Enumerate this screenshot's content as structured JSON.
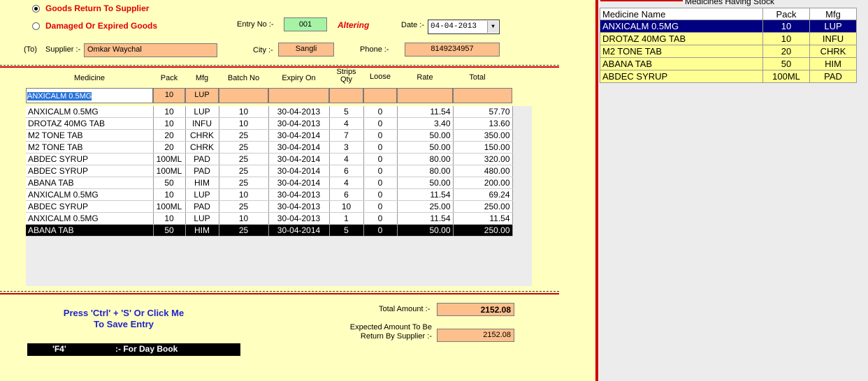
{
  "mode": {
    "option1": "Goods Return To Supplier",
    "option2": "Damaged Or Expired Goods"
  },
  "entry": {
    "label": "Entry No :-",
    "value": "001",
    "status": "Altering"
  },
  "date": {
    "label": "Date :-",
    "value": "04-04-2013"
  },
  "supplier": {
    "prefix": "(To)",
    "label": "Supplier :-",
    "value": "Omkar Waychal"
  },
  "city": {
    "label": "City :-",
    "value": "Sangli"
  },
  "phone": {
    "label": "Phone :-",
    "value": "8149234957"
  },
  "columns": {
    "medicine": "Medicine",
    "pack": "Pack",
    "mfg": "Mfg",
    "batch": "Batch No",
    "expiry": "Expiry On",
    "strips1": "Strips",
    "strips2": "Qty",
    "loose": "Loose",
    "rate": "Rate",
    "total": "Total"
  },
  "entry_row": {
    "medicine": "ANXICALM 0.5MG",
    "pack": "10",
    "mfg": "LUP"
  },
  "rows": [
    {
      "medicine": "ANXICALM 0.5MG",
      "pack": "10",
      "mfg": "LUP",
      "batch": "10",
      "expiry": "30-04-2013",
      "qty": "5",
      "loose": "0",
      "rate": "11.54",
      "total": "57.70"
    },
    {
      "medicine": "DROTAZ  40MG TAB",
      "pack": "10",
      "mfg": "INFU",
      "batch": "10",
      "expiry": "30-04-2013",
      "qty": "4",
      "loose": "0",
      "rate": "3.40",
      "total": "13.60"
    },
    {
      "medicine": "M2 TONE TAB",
      "pack": "20",
      "mfg": "CHRK",
      "batch": "25",
      "expiry": "30-04-2014",
      "qty": "7",
      "loose": "0",
      "rate": "50.00",
      "total": "350.00"
    },
    {
      "medicine": "M2 TONE TAB",
      "pack": "20",
      "mfg": "CHRK",
      "batch": "25",
      "expiry": "30-04-2014",
      "qty": "3",
      "loose": "0",
      "rate": "50.00",
      "total": "150.00"
    },
    {
      "medicine": "ABDEC SYRUP",
      "pack": "100ML",
      "mfg": "PAD",
      "batch": "25",
      "expiry": "30-04-2014",
      "qty": "4",
      "loose": "0",
      "rate": "80.00",
      "total": "320.00"
    },
    {
      "medicine": "ABDEC SYRUP",
      "pack": "100ML",
      "mfg": "PAD",
      "batch": "25",
      "expiry": "30-04-2014",
      "qty": "6",
      "loose": "0",
      "rate": "80.00",
      "total": "480.00"
    },
    {
      "medicine": "ABANA TAB",
      "pack": "50",
      "mfg": "HIM",
      "batch": "25",
      "expiry": "30-04-2014",
      "qty": "4",
      "loose": "0",
      "rate": "50.00",
      "total": "200.00"
    },
    {
      "medicine": "ANXICALM 0.5MG",
      "pack": "10",
      "mfg": "LUP",
      "batch": "10",
      "expiry": "30-04-2013",
      "qty": "6",
      "loose": "0",
      "rate": "11.54",
      "total": "69.24"
    },
    {
      "medicine": "ABDEC SYRUP",
      "pack": "100ML",
      "mfg": "PAD",
      "batch": "25",
      "expiry": "30-04-2013",
      "qty": "10",
      "loose": "0",
      "rate": "25.00",
      "total": "250.00"
    },
    {
      "medicine": "ANXICALM 0.5MG",
      "pack": "10",
      "mfg": "LUP",
      "batch": "10",
      "expiry": "30-04-2013",
      "qty": "1",
      "loose": "0",
      "rate": "11.54",
      "total": "11.54"
    },
    {
      "medicine": "ABANA TAB",
      "pack": "50",
      "mfg": "HIM",
      "batch": "25",
      "expiry": "30-04-2014",
      "qty": "5",
      "loose": "0",
      "rate": "50.00",
      "total": "250.00"
    }
  ],
  "selected_row": 10,
  "footer": {
    "save_line1": "Press 'Ctrl' + 'S' Or Click Me",
    "save_line2": "To Save Entry",
    "f4_key": "'F4'",
    "f4_label": ":-  For Day Book",
    "total_label": "Total Amount :-",
    "total_value": "2152.08",
    "expected_label1": "Expected Amount To Be",
    "expected_label2": "Return By Supplier :-",
    "expected_value": "2152.08"
  },
  "stock": {
    "title": "Medicines Having Stock",
    "headers": {
      "name": "Medicine Name",
      "pack": "Pack",
      "mfg": "Mfg"
    },
    "rows": [
      {
        "name": "ANXICALM 0.5MG",
        "pack": "10",
        "mfg": "LUP"
      },
      {
        "name": "DROTAZ  40MG TAB",
        "pack": "10",
        "mfg": "INFU"
      },
      {
        "name": "M2 TONE TAB",
        "pack": "20",
        "mfg": "CHRK"
      },
      {
        "name": "ABANA TAB",
        "pack": "50",
        "mfg": "HIM"
      },
      {
        "name": "ABDEC SYRUP",
        "pack": "100ML",
        "mfg": "PAD"
      }
    ],
    "selected_row": 0
  },
  "colors": {
    "background": "#ffffc0",
    "accent_red": "#d00000",
    "field_orange": "#fdbf8b",
    "selection_navy": "#000080"
  }
}
